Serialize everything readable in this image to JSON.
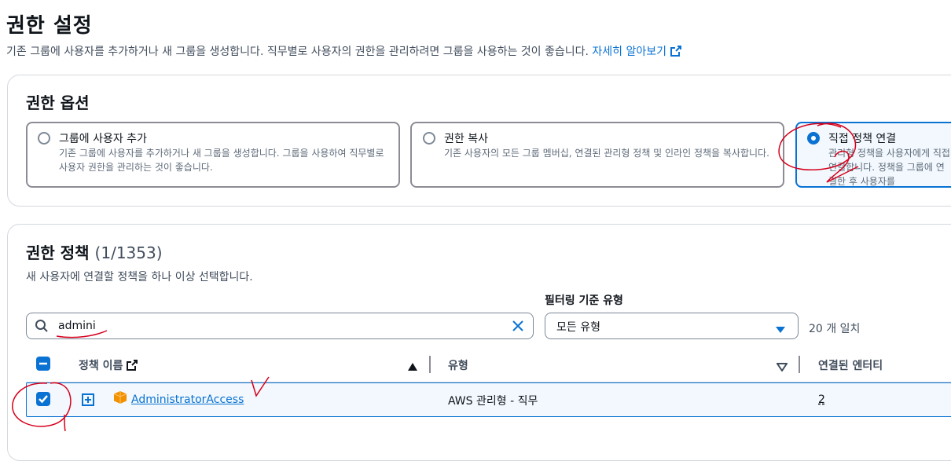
{
  "page": {
    "title": "권한 설정",
    "description": "기존 그룹에 사용자를 추가하거나 새 그룹을 생성합니다. 직무별로 사용자의 권한을 관리하려면 그룹을 사용하는 것이 좋습니다.",
    "learn_more": "자세히 알아보기"
  },
  "options": {
    "title": "권한 옵션",
    "tiles": [
      {
        "label": "그룹에 사용자 추가",
        "desc": "기존 그룹에 사용자를 추가하거나 새 그룹을 생성합니다. 그룹을 사용하여 직무별로 사용자 권한을 관리하는 것이 좋습니다.",
        "selected": false
      },
      {
        "label": "권한 복사",
        "desc": "기존 사용자의 모든 그룹 멤버십, 연결된 관리형 정책 및 인라인 정책을 복사합니다.",
        "selected": false
      },
      {
        "label": "직접 정책 연결",
        "desc": "관리형 정책을 사용자에게 직접 연결합니다. 정책을 그룹에 연결한 후 사용자를",
        "selected": true
      }
    ]
  },
  "policies": {
    "title": "권한 정책",
    "count": "(1/1353)",
    "subtitle": "새 사용자에 연결할 정책을 하나 이상 선택합니다.",
    "filter_label": "필터링 기준 유형",
    "search_value": "admini",
    "type_select": "모든 유형",
    "match_count": "20 개 일치",
    "columns": {
      "name": "정책 이름",
      "type": "유형",
      "entities": "연결된 엔터티"
    },
    "rows": [
      {
        "name": "AdministratorAccess",
        "type": "AWS 관리형 - 직무",
        "entities": "2",
        "checked": true
      }
    ]
  },
  "colors": {
    "accent": "#0972d3",
    "annotation": "#d6001c"
  }
}
